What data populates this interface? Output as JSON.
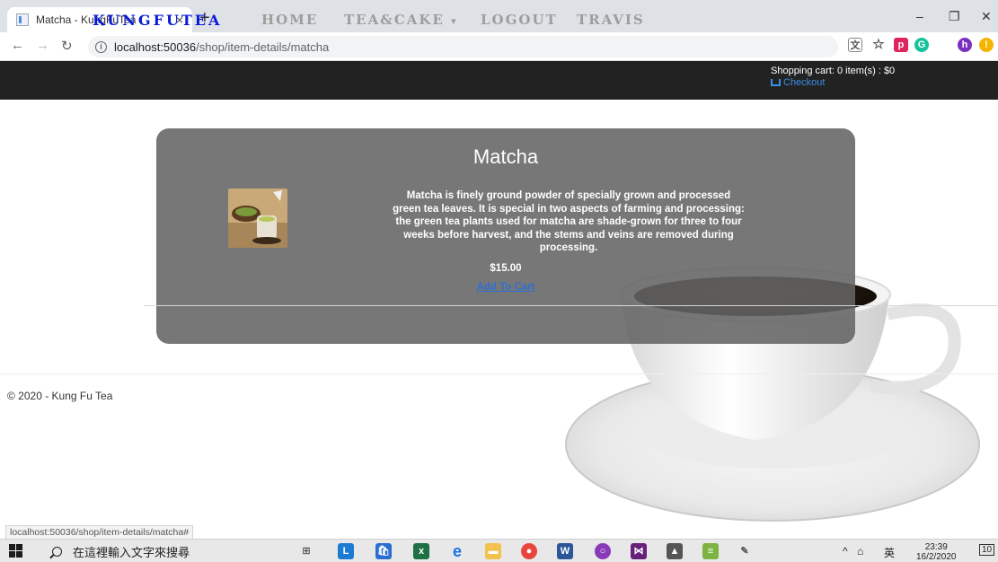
{
  "browser": {
    "tab_title": "Matcha - KungFuTea",
    "tab_close": "×",
    "new_tab": "+",
    "url_host": "localhost:50036",
    "url_path": "/shop/item-details/matcha",
    "status_url": "localhost:50036/shop/item-details/matcha#",
    "info_glyph": "i"
  },
  "nav": {
    "brand": "KungFuTea",
    "links": [
      "Home",
      "Tea&Cake",
      "Logout",
      "Travis"
    ],
    "dropdown_caret": "▾",
    "cart_summary": "Shopping cart: 0 item(s) : $0",
    "checkout_label": "Checkout"
  },
  "product": {
    "name": "Matcha",
    "description": "Matcha is finely ground powder of specially grown and processed green tea leaves. It is special in two aspects of farming and processing: the green tea plants used for matcha are shade-grown for three to four weeks before harvest, and the stems and veins are removed during processing.",
    "price": "$15.00",
    "add_to_cart": "Add To Cart"
  },
  "footer": {
    "text": "© 2020 - Kung Fu Tea"
  },
  "taskbar": {
    "search_placeholder": "在這裡輸入文字來搜尋",
    "tray_lang": "英",
    "time": "23:39",
    "date": "16/2/2020",
    "notification_count": "10"
  },
  "colors": {
    "brand": "#0a1bd6",
    "nav_bg": "#222222",
    "link": "#3a8ee6",
    "panel": "#646464"
  }
}
